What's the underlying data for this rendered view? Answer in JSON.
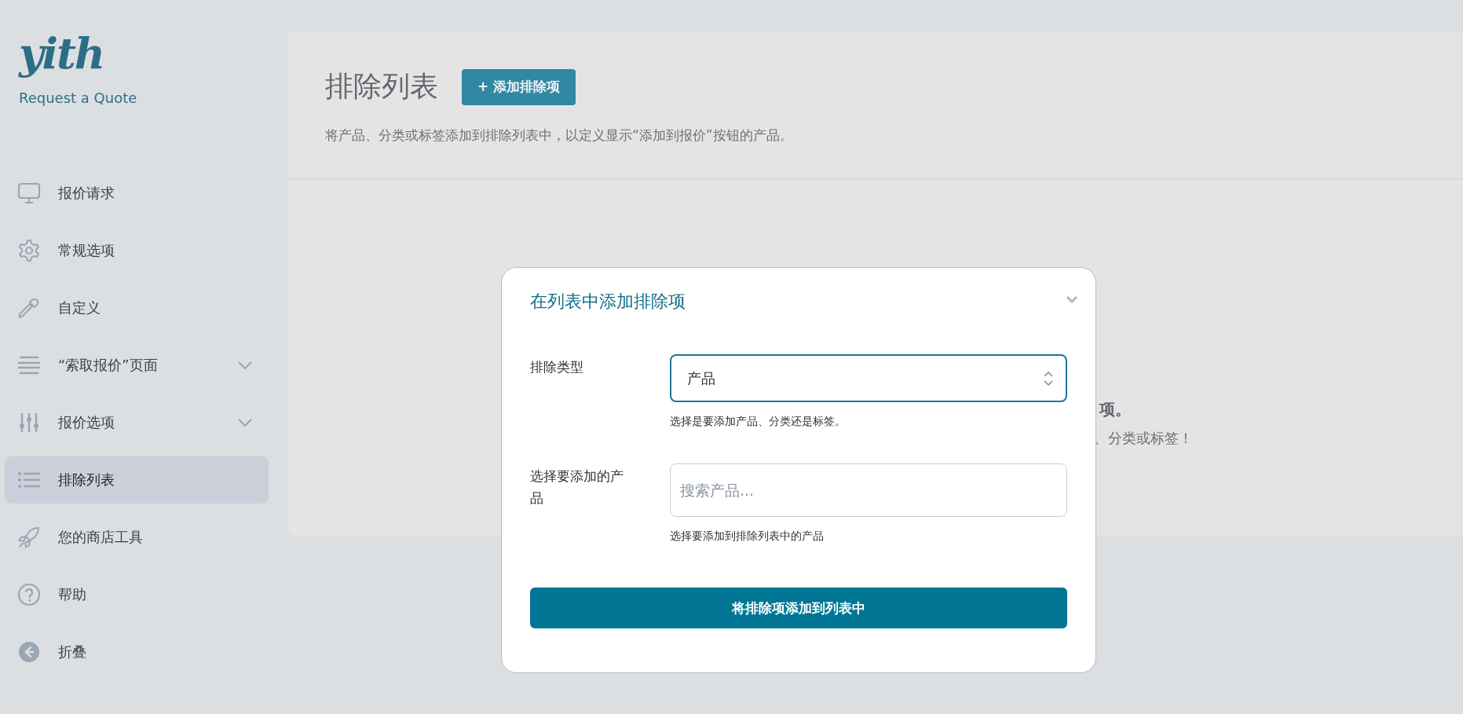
{
  "brand": {
    "logo": "yith",
    "product": "Request a Quote"
  },
  "sidebar": {
    "items": [
      {
        "label": "报价请求",
        "kind": "link",
        "selected": false
      },
      {
        "label": "常规选项",
        "kind": "link",
        "selected": false
      },
      {
        "label": "自定义",
        "kind": "link",
        "selected": false
      },
      {
        "label": "“索取报价”页面",
        "kind": "submenu",
        "selected": false
      },
      {
        "label": "报价选项",
        "kind": "submenu",
        "selected": false
      },
      {
        "label": "排除列表",
        "kind": "link",
        "selected": true
      },
      {
        "label": "您的商店工具",
        "kind": "link",
        "selected": false
      },
      {
        "label": "帮助",
        "kind": "link",
        "selected": false
      },
      {
        "label": "折叠",
        "kind": "collapse",
        "selected": false
      }
    ]
  },
  "page": {
    "title": "排除列表",
    "add_button": "+ 添加排除项",
    "description": "将产品、分类或标签添加到排除列表中，以定义显示“添加到报价”按钮的产品。",
    "empty_state": {
      "heading": "项。",
      "text": "、分类或标签！"
    }
  },
  "modal": {
    "title": "在列表中添加排除项",
    "fields": [
      {
        "kind": "select",
        "label": "排除类型",
        "value": "产品",
        "help": "选择是要添加产品、分类还是标签。"
      },
      {
        "kind": "search",
        "label": "选择要添加的产品",
        "placeholder": "搜索产品...",
        "help": "选择要添加到排除列表中的产品"
      }
    ],
    "submit": "将排除项添加到列表中"
  }
}
